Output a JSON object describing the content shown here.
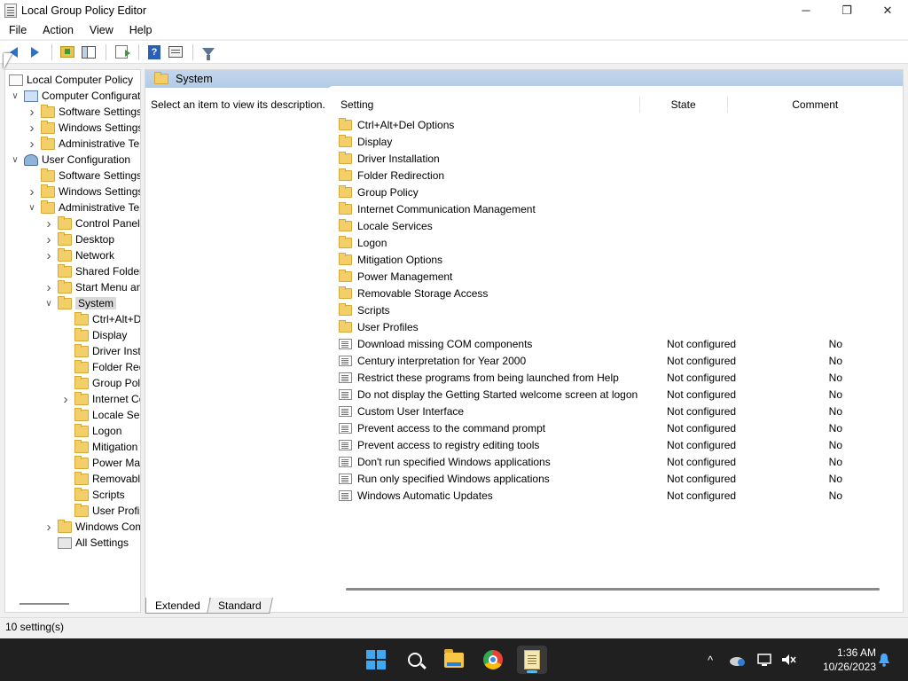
{
  "window": {
    "title": "Local Group Policy Editor",
    "controls": {
      "minimize": "─",
      "maximize": "❐",
      "close": "✕"
    }
  },
  "menu": [
    "File",
    "Action",
    "View",
    "Help"
  ],
  "toolbar": {
    "buttons": [
      "back-icon",
      "forward-icon",
      "up-folder-icon",
      "show-hide-tree-icon",
      "export-list-icon",
      "help-icon",
      "properties-icon",
      "filter-icon"
    ]
  },
  "tree": [
    {
      "label": "Local Computer Policy",
      "level": 0,
      "icon": "policy-icon",
      "chev": ""
    },
    {
      "label": "Computer Configuration",
      "level": 1,
      "icon": "computer-icon",
      "chev": "v"
    },
    {
      "label": "Software Settings",
      "level": 2,
      "icon": "folder-icon",
      "chev": ">"
    },
    {
      "label": "Windows Settings",
      "level": 2,
      "icon": "folder-icon",
      "chev": ">"
    },
    {
      "label": "Administrative Templates",
      "level": 2,
      "icon": "folder-icon",
      "chev": ">"
    },
    {
      "label": "User Configuration",
      "level": 1,
      "icon": "user-icon",
      "chev": "v"
    },
    {
      "label": "Software Settings",
      "level": 2,
      "icon": "folder-icon",
      "chev": ""
    },
    {
      "label": "Windows Settings",
      "level": 2,
      "icon": "folder-icon",
      "chev": ">"
    },
    {
      "label": "Administrative Templates",
      "level": 2,
      "icon": "folder-icon",
      "chev": "v"
    },
    {
      "label": "Control Panel",
      "level": 3,
      "icon": "folder-icon",
      "chev": ">"
    },
    {
      "label": "Desktop",
      "level": 3,
      "icon": "folder-icon",
      "chev": ">"
    },
    {
      "label": "Network",
      "level": 3,
      "icon": "folder-icon",
      "chev": ">"
    },
    {
      "label": "Shared Folders",
      "level": 3,
      "icon": "folder-icon",
      "chev": ""
    },
    {
      "label": "Start Menu and Taskbar",
      "level": 3,
      "icon": "folder-icon",
      "chev": ">"
    },
    {
      "label": "System",
      "level": 3,
      "icon": "folder-icon",
      "chev": "v",
      "selected": true
    },
    {
      "label": "Ctrl+Alt+Del Options",
      "level": 4,
      "icon": "folder-icon",
      "chev": ""
    },
    {
      "label": "Display",
      "level": 4,
      "icon": "folder-icon",
      "chev": ""
    },
    {
      "label": "Driver Installation",
      "level": 4,
      "icon": "folder-icon",
      "chev": ""
    },
    {
      "label": "Folder Redirection",
      "level": 4,
      "icon": "folder-icon",
      "chev": ""
    },
    {
      "label": "Group Policy",
      "level": 4,
      "icon": "folder-icon",
      "chev": ""
    },
    {
      "label": "Internet Communication Management",
      "level": 4,
      "icon": "folder-icon",
      "chev": ">"
    },
    {
      "label": "Locale Services",
      "level": 4,
      "icon": "folder-icon",
      "chev": ""
    },
    {
      "label": "Logon",
      "level": 4,
      "icon": "folder-icon",
      "chev": ""
    },
    {
      "label": "Mitigation Options",
      "level": 4,
      "icon": "folder-icon",
      "chev": ""
    },
    {
      "label": "Power Management",
      "level": 4,
      "icon": "folder-icon",
      "chev": ""
    },
    {
      "label": "Removable Storage Access",
      "level": 4,
      "icon": "folder-icon",
      "chev": ""
    },
    {
      "label": "Scripts",
      "level": 4,
      "icon": "folder-icon",
      "chev": ""
    },
    {
      "label": "User Profiles",
      "level": 4,
      "icon": "folder-icon",
      "chev": ""
    },
    {
      "label": "Windows Components",
      "level": 3,
      "icon": "folder-icon",
      "chev": ">"
    },
    {
      "label": "All Settings",
      "level": 3,
      "icon": "settings-icon",
      "chev": ""
    }
  ],
  "pane": {
    "header_title": "System",
    "description": "Select an item to view its description.",
    "columns": {
      "setting": "Setting",
      "state": "State",
      "comment": "Comment"
    },
    "rows": [
      {
        "type": "folder",
        "name": "Ctrl+Alt+Del Options",
        "state": "",
        "comment": ""
      },
      {
        "type": "folder",
        "name": "Display",
        "state": "",
        "comment": ""
      },
      {
        "type": "folder",
        "name": "Driver Installation",
        "state": "",
        "comment": ""
      },
      {
        "type": "folder",
        "name": "Folder Redirection",
        "state": "",
        "comment": ""
      },
      {
        "type": "folder",
        "name": "Group Policy",
        "state": "",
        "comment": ""
      },
      {
        "type": "folder",
        "name": "Internet Communication Management",
        "state": "",
        "comment": ""
      },
      {
        "type": "folder",
        "name": "Locale Services",
        "state": "",
        "comment": ""
      },
      {
        "type": "folder",
        "name": "Logon",
        "state": "",
        "comment": ""
      },
      {
        "type": "folder",
        "name": "Mitigation Options",
        "state": "",
        "comment": ""
      },
      {
        "type": "folder",
        "name": "Power Management",
        "state": "",
        "comment": ""
      },
      {
        "type": "folder",
        "name": "Removable Storage Access",
        "state": "",
        "comment": ""
      },
      {
        "type": "folder",
        "name": "Scripts",
        "state": "",
        "comment": ""
      },
      {
        "type": "folder",
        "name": "User Profiles",
        "state": "",
        "comment": ""
      },
      {
        "type": "setting",
        "name": "Download missing COM components",
        "state": "Not configured",
        "comment": "No"
      },
      {
        "type": "setting",
        "name": "Century interpretation for Year 2000",
        "state": "Not configured",
        "comment": "No"
      },
      {
        "type": "setting",
        "name": "Restrict these programs from being launched from Help",
        "state": "Not configured",
        "comment": "No"
      },
      {
        "type": "setting",
        "name": "Do not display the Getting Started welcome screen at logon",
        "state": "Not configured",
        "comment": "No"
      },
      {
        "type": "setting",
        "name": "Custom User Interface",
        "state": "Not configured",
        "comment": "No"
      },
      {
        "type": "setting",
        "name": "Prevent access to the command prompt",
        "state": "Not configured",
        "comment": "No"
      },
      {
        "type": "setting",
        "name": "Prevent access to registry editing tools",
        "state": "Not configured",
        "comment": "No"
      },
      {
        "type": "setting",
        "name": "Don't run specified Windows applications",
        "state": "Not configured",
        "comment": "No"
      },
      {
        "type": "setting",
        "name": "Run only specified Windows applications",
        "state": "Not configured",
        "comment": "No"
      },
      {
        "type": "setting",
        "name": "Windows Automatic Updates",
        "state": "Not configured",
        "comment": "No"
      }
    ]
  },
  "tabs": {
    "extended": "Extended",
    "standard": "Standard"
  },
  "status": {
    "text": "10 setting(s)"
  },
  "taskbar": {
    "apps": [
      "start-icon",
      "search-icon",
      "file-explorer-icon",
      "chrome-icon",
      "group-policy-editor-icon"
    ],
    "tray": {
      "chevron": "^",
      "time": "1:36 AM",
      "date": "10/26/2023"
    }
  },
  "colors": {
    "header_bg": "#b7cde8",
    "taskbar_bg": "#202020",
    "accent": "#2a72c8"
  }
}
